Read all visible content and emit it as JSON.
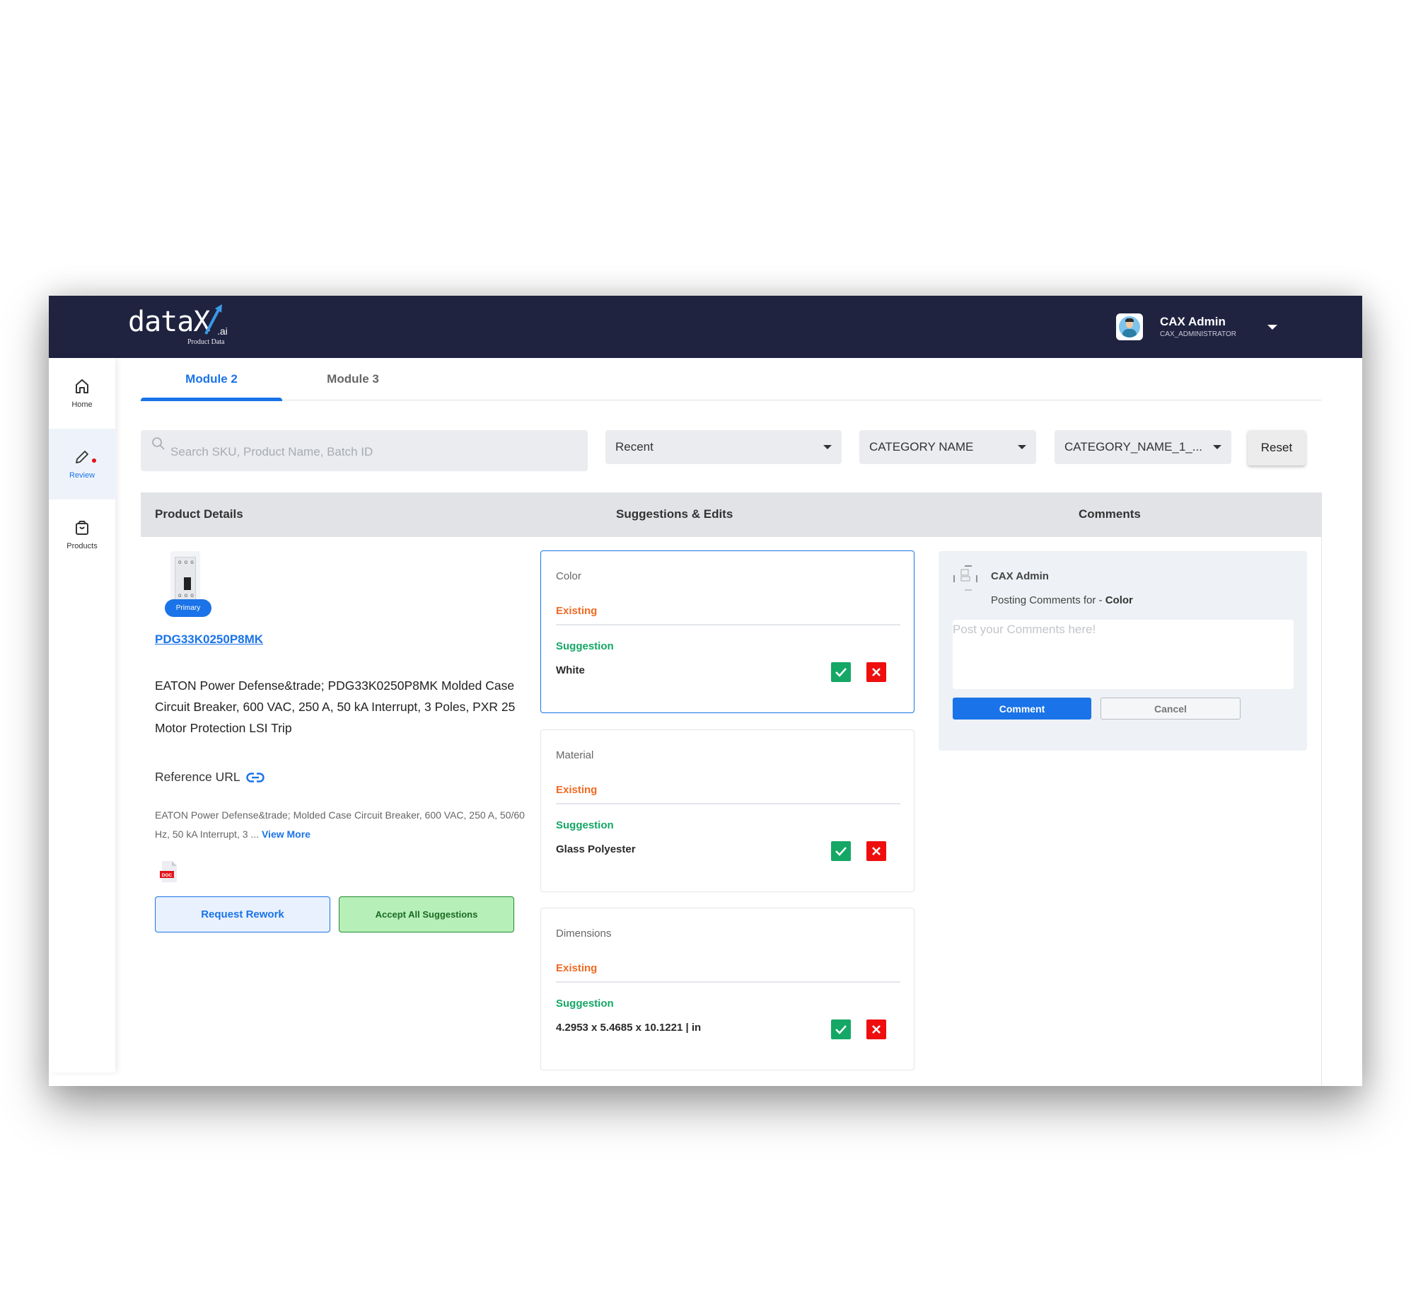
{
  "header": {
    "logo_text": "data",
    "logo_x": "X",
    "logo_suffix": ".ai",
    "logo_tagline": "Product Data",
    "user_name": "CAX Admin",
    "user_role": "CAX_ADMINISTRATOR"
  },
  "sidebar": {
    "items": [
      {
        "label": "Home",
        "icon": "home-icon",
        "active": false
      },
      {
        "label": "Review",
        "icon": "pencil-icon",
        "active": true,
        "notification": true
      },
      {
        "label": "Products",
        "icon": "shopping-bag-icon",
        "active": false
      }
    ]
  },
  "tabs": [
    {
      "label": "Module 2",
      "active": true
    },
    {
      "label": "Module 3",
      "active": false
    }
  ],
  "filters": {
    "search_placeholder": "Search SKU, Product Name, Batch ID",
    "search_value": "",
    "sort_select": "Recent",
    "category_select": "CATEGORY NAME",
    "subcategory_select": "CATEGORY_NAME_1_...",
    "reset_label": "Reset"
  },
  "columns": {
    "product": "Product Details",
    "suggestions": "Suggestions & Edits",
    "comments": "Comments"
  },
  "product": {
    "image_badge": "Primary",
    "sku": "PDG33K0250P8MK",
    "title": "EATON Power Defense&trade; PDG33K0250P8MK Molded Case Circuit Breaker, 600 VAC, 250 A, 50 kA Interrupt, 3 Poles, PXR 25 Motor Protection LSI Trip",
    "reference_label": "Reference URL",
    "description": "EATON Power Defense&trade; Molded Case Circuit Breaker, 600 VAC, 250 A, 50/60 Hz, 50 kA Interrupt, 3 ...",
    "view_more": "View More",
    "doc_label": "DOC",
    "request_rework": "Request Rework",
    "accept_all": "Accept All Suggestions"
  },
  "suggestions": [
    {
      "attribute": "Color",
      "existing_label": "Existing",
      "existing_value": "",
      "suggestion_label": "Suggestion",
      "suggestion_value": "White",
      "selected": true
    },
    {
      "attribute": "Material",
      "existing_label": "Existing",
      "existing_value": "",
      "suggestion_label": "Suggestion",
      "suggestion_value": "Glass Polyester",
      "selected": false
    },
    {
      "attribute": "Dimensions",
      "existing_label": "Existing",
      "existing_value": "",
      "suggestion_label": "Suggestion",
      "suggestion_value": "4.2953 x 5.4685 x 10.1221 | in",
      "selected": false
    }
  ],
  "comments": {
    "user": "CAX Admin",
    "posting_prefix": "Posting Comments for - ",
    "posting_attribute": "Color",
    "placeholder": "Post your Comments here!",
    "comment_button": "Comment",
    "cancel_button": "Cancel"
  },
  "colors": {
    "header_bg": "#1f2340",
    "accent": "#1a73e8",
    "existing": "#f06a23",
    "suggestion": "#14a765",
    "reject": "#ef0e0e"
  }
}
